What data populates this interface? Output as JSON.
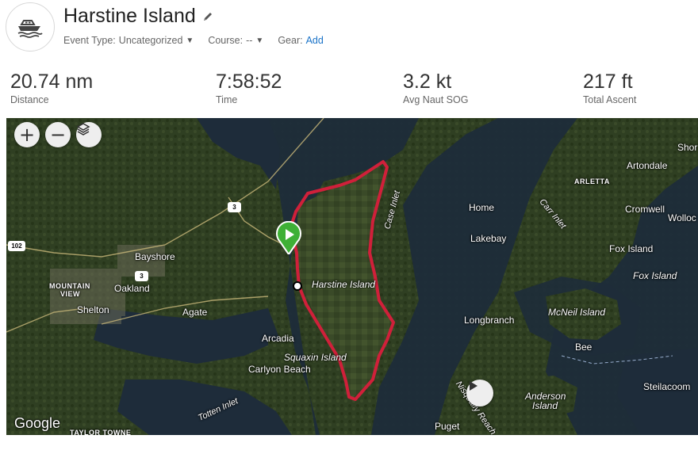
{
  "activity": {
    "title": "Harstine Island",
    "icon": "boat-icon",
    "event_type_label": "Event Type:",
    "event_type_value": "Uncategorized",
    "course_label": "Course:",
    "course_value": "--",
    "gear_label": "Gear:",
    "gear_action": "Add"
  },
  "stats": [
    {
      "value": "20.74 nm",
      "label": "Distance"
    },
    {
      "value": "7:58:52",
      "label": "Time"
    },
    {
      "value": "3.2 kt",
      "label": "Avg Naut SOG"
    },
    {
      "value": "217 ft",
      "label": "Total Ascent"
    }
  ],
  "map": {
    "zoom_in": "+",
    "zoom_out": "−",
    "attribution": "Google",
    "route_color": "#d0203a",
    "start_color": "#3eb036",
    "places": {
      "harstine_island": "Harstine Island",
      "squaxin_island": "Squaxin Island",
      "case_inlet": "Case Inlet",
      "carr_inlet": "Carr Inlet",
      "nisqually_reach": "Nisqually Reach",
      "totten_inlet": "Totten Inlet",
      "home": "Home",
      "lakebay": "Lakebay",
      "longbranch": "Longbranch",
      "fox_island_town": "Fox Island",
      "fox_island": "Fox Island",
      "mcneil_island": "McNeil Island",
      "bee": "Bee",
      "anderson_island": "Anderson Island",
      "steilacoom": "Steilacoom",
      "puget": "Puget",
      "bayshore": "Bayshore",
      "oakland": "Oakland",
      "shelton": "Shelton",
      "agate": "Agate",
      "arcadia": "Arcadia",
      "carlyon_beach": "Carlyon Beach",
      "artondale": "Artondale",
      "arletta": "ARLETTA",
      "cromwell": "Cromwell",
      "wollochet": "Wolloc",
      "shore": "Shor",
      "mountain_view_1": "MOUNTAIN",
      "mountain_view_2": "VIEW",
      "taylor_towne": "TAYLOR TOWNE"
    },
    "shields": {
      "route_3_north": "3",
      "route_3_south": "3",
      "route_102": "102"
    }
  }
}
